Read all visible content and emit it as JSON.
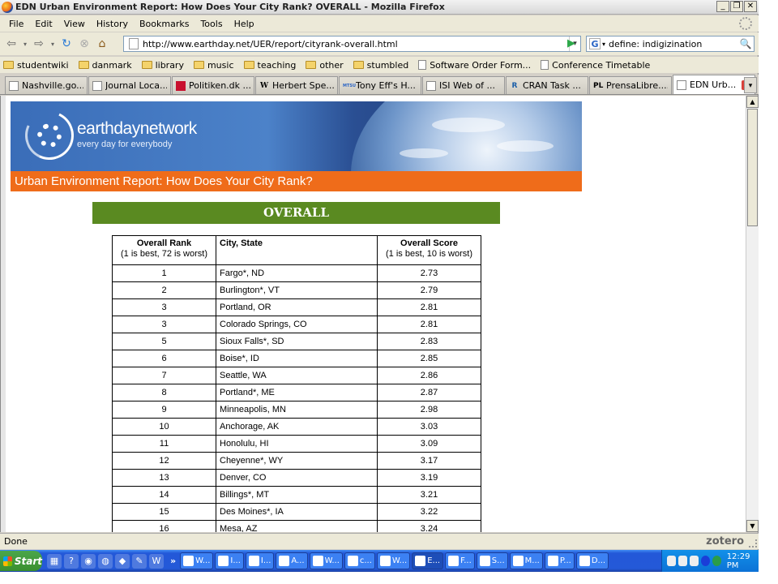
{
  "window": {
    "title": "EDN Urban Environment Report: How Does Your City Rank? OVERALL - Mozilla Firefox"
  },
  "menu": [
    "File",
    "Edit",
    "View",
    "History",
    "Bookmarks",
    "Tools",
    "Help"
  ],
  "nav": {
    "url": "http://www.earthday.net/UER/report/cityrank-overall.html",
    "search": "define: indigizination"
  },
  "bookmarks": [
    {
      "label": "studentwiki",
      "type": "folder"
    },
    {
      "label": "danmark",
      "type": "folder"
    },
    {
      "label": "library",
      "type": "folder"
    },
    {
      "label": "music",
      "type": "folder"
    },
    {
      "label": "teaching",
      "type": "folder"
    },
    {
      "label": "other",
      "type": "folder"
    },
    {
      "label": "stumbled",
      "type": "folder"
    },
    {
      "label": "Software Order Form...",
      "type": "page"
    },
    {
      "label": "Conference Timetable",
      "type": "page"
    }
  ],
  "tabs": [
    {
      "label": "Nashville.go...",
      "icon": ""
    },
    {
      "label": "Journal Loca...",
      "icon": ""
    },
    {
      "label": "Politiken.dk ...",
      "icon": ""
    },
    {
      "label": "Herbert Spe...",
      "icon": "W"
    },
    {
      "label": "Tony Eff's H...",
      "icon": "MTSU"
    },
    {
      "label": "ISI Web of ...",
      "icon": ""
    },
    {
      "label": "CRAN Task ...",
      "icon": "R"
    },
    {
      "label": "PrensaLibre....",
      "icon": "PL"
    },
    {
      "label": "EDN Urb...",
      "icon": "",
      "active": true
    }
  ],
  "banner": {
    "logo_name": "earthdaynetwork",
    "tagline": "every day for everybody",
    "report_title": "Urban Environment Report: How Does Your City Rank?"
  },
  "section_title": "OVERALL",
  "table": {
    "headers": [
      {
        "title": "Overall Rank",
        "sub": "(1 is best, 72 is worst)"
      },
      {
        "title": "City, State",
        "sub": ""
      },
      {
        "title": "Overall Score",
        "sub": "(1 is best, 10 is worst)"
      }
    ],
    "rows": [
      [
        "1",
        "Fargo*, ND",
        "2.73"
      ],
      [
        "2",
        "Burlington*, VT",
        "2.79"
      ],
      [
        "3",
        "Portland, OR",
        "2.81"
      ],
      [
        "3",
        "Colorado Springs, CO",
        "2.81"
      ],
      [
        "5",
        "Sioux Falls*, SD",
        "2.83"
      ],
      [
        "6",
        "Boise*, ID",
        "2.85"
      ],
      [
        "7",
        "Seattle, WA",
        "2.86"
      ],
      [
        "8",
        "Portland*, ME",
        "2.87"
      ],
      [
        "9",
        "Minneapolis, MN",
        "2.98"
      ],
      [
        "10",
        "Anchorage, AK",
        "3.03"
      ],
      [
        "11",
        "Honolulu, HI",
        "3.09"
      ],
      [
        "12",
        "Cheyenne*, WY",
        "3.17"
      ],
      [
        "13",
        "Denver, CO",
        "3.19"
      ],
      [
        "14",
        "Billings*, MT",
        "3.21"
      ],
      [
        "15",
        "Des Moines*, IA",
        "3.22"
      ],
      [
        "16",
        "Mesa, AZ",
        "3.24"
      ]
    ]
  },
  "status": {
    "text": "Done",
    "zotero": "zotero"
  },
  "taskbar": {
    "start": "Start",
    "buttons": [
      "W...",
      "I...",
      "I...",
      "A...",
      "W...",
      "c...",
      "W...",
      "E...",
      "F...",
      "S...",
      "M...",
      "P...",
      "D..."
    ],
    "active_index": 7,
    "clock": "12:29 PM"
  }
}
